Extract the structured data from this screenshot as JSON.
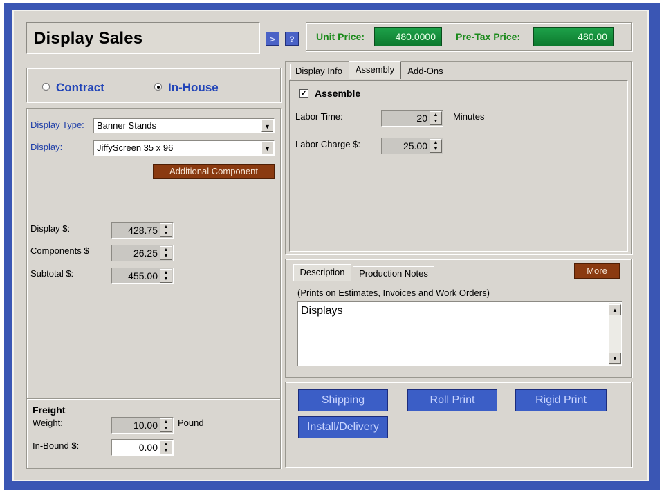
{
  "header": {
    "title": "Display Sales",
    "nav_button_glyph": ">",
    "help_button_glyph": "?",
    "unit_price_label": "Unit Price:",
    "unit_price_value": "480.0000",
    "pretax_price_label": "Pre-Tax Price:",
    "pretax_price_value": "480.00"
  },
  "radio": {
    "contract_label": "Contract",
    "inhouse_label": "In-House",
    "selected": "In-House"
  },
  "display_form": {
    "display_type_label": "Display Type:",
    "display_type_value": "Banner Stands",
    "display_label": "Display:",
    "display_value": "JiffyScreen 35 x 96",
    "additional_component_label": "Additional Component",
    "display_cost_label": "Display $:",
    "display_cost_value": "428.75",
    "components_label": "Components $",
    "components_value": "26.25",
    "subtotal_label": "Subtotal $:",
    "subtotal_value": "455.00"
  },
  "freight": {
    "title": "Freight",
    "weight_label": "Weight:",
    "weight_value": "10.00",
    "weight_unit": "Pound",
    "inbound_label": "In-Bound $:",
    "inbound_value": "0.00"
  },
  "tabs_upper": {
    "tabs": [
      "Display Info",
      "Assembly",
      "Add-Ons"
    ],
    "active": "Assembly",
    "assemble_label": "Assemble",
    "assemble_checked": true,
    "labor_time_label": "Labor Time:",
    "labor_time_value": "20",
    "labor_time_unit": "Minutes",
    "labor_charge_label": "Labor Charge $:",
    "labor_charge_value": "25.00"
  },
  "tabs_lower": {
    "tabs": [
      "Description",
      "Production Notes"
    ],
    "active": "Description",
    "more_label": "More",
    "hint": "(Prints on Estimates, Invoices and Work Orders)",
    "text": "Displays"
  },
  "buttons": {
    "shipping": "Shipping",
    "roll_print": "Roll Print",
    "rigid_print": "Rigid Print",
    "install_delivery": "Install/Delivery"
  },
  "colors": {
    "frame": "#3a56b4",
    "window": "#d9d6d0",
    "price_green": "#1ea24a",
    "accent_orange": "#8a3a10",
    "button_blue": "#3b5ec6",
    "label_blue": "#1e3ea8"
  }
}
